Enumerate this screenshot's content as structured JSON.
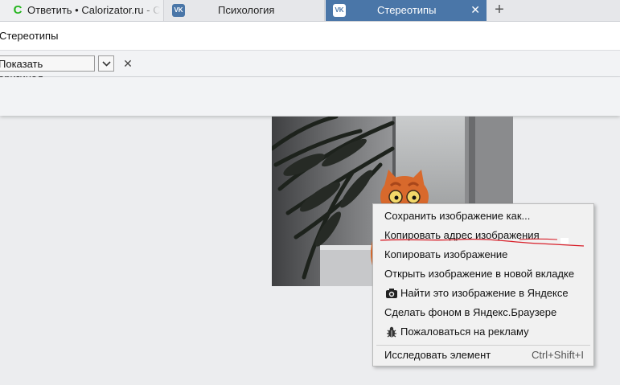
{
  "tabs": [
    {
      "title": "Ответить • Calorizator.ru - С",
      "favicon": "calorizator-c-icon",
      "favicon_text": "C",
      "active": false
    },
    {
      "title": "Психология",
      "favicon": "vk-icon",
      "favicon_text": "VK",
      "active": false
    },
    {
      "title": "Стереотипы",
      "favicon": "vk-icon",
      "favicon_text": "VK",
      "active": true,
      "close": "✕"
    }
  ],
  "new_tab_label": "+",
  "address": {
    "text": "Стереотипы"
  },
  "translate_bar": {
    "show_original_label": "Показать оригинал",
    "close_glyph": "✕"
  },
  "context_menu": {
    "items": [
      {
        "label": "Сохранить изображение как..."
      },
      {
        "label": "Копировать адрес изображения"
      },
      {
        "label": "Копировать изображение"
      },
      {
        "label": "Открыть изображение в новой вкладке"
      },
      {
        "label": "Найти это изображение в Яндексе",
        "icon": "camera-search-icon"
      },
      {
        "label": "Сделать фоном в Яндекс.Браузере"
      },
      {
        "label": "Пожаловаться на рекламу",
        "icon": "bug-icon"
      },
      {
        "label": "Исследовать элемент",
        "shortcut": "Ctrl+Shift+I"
      }
    ]
  },
  "colors": {
    "active_tab": "#4a76a8",
    "calorizator_favicon": "#24b41e",
    "annotation_red": "#d8202a"
  }
}
